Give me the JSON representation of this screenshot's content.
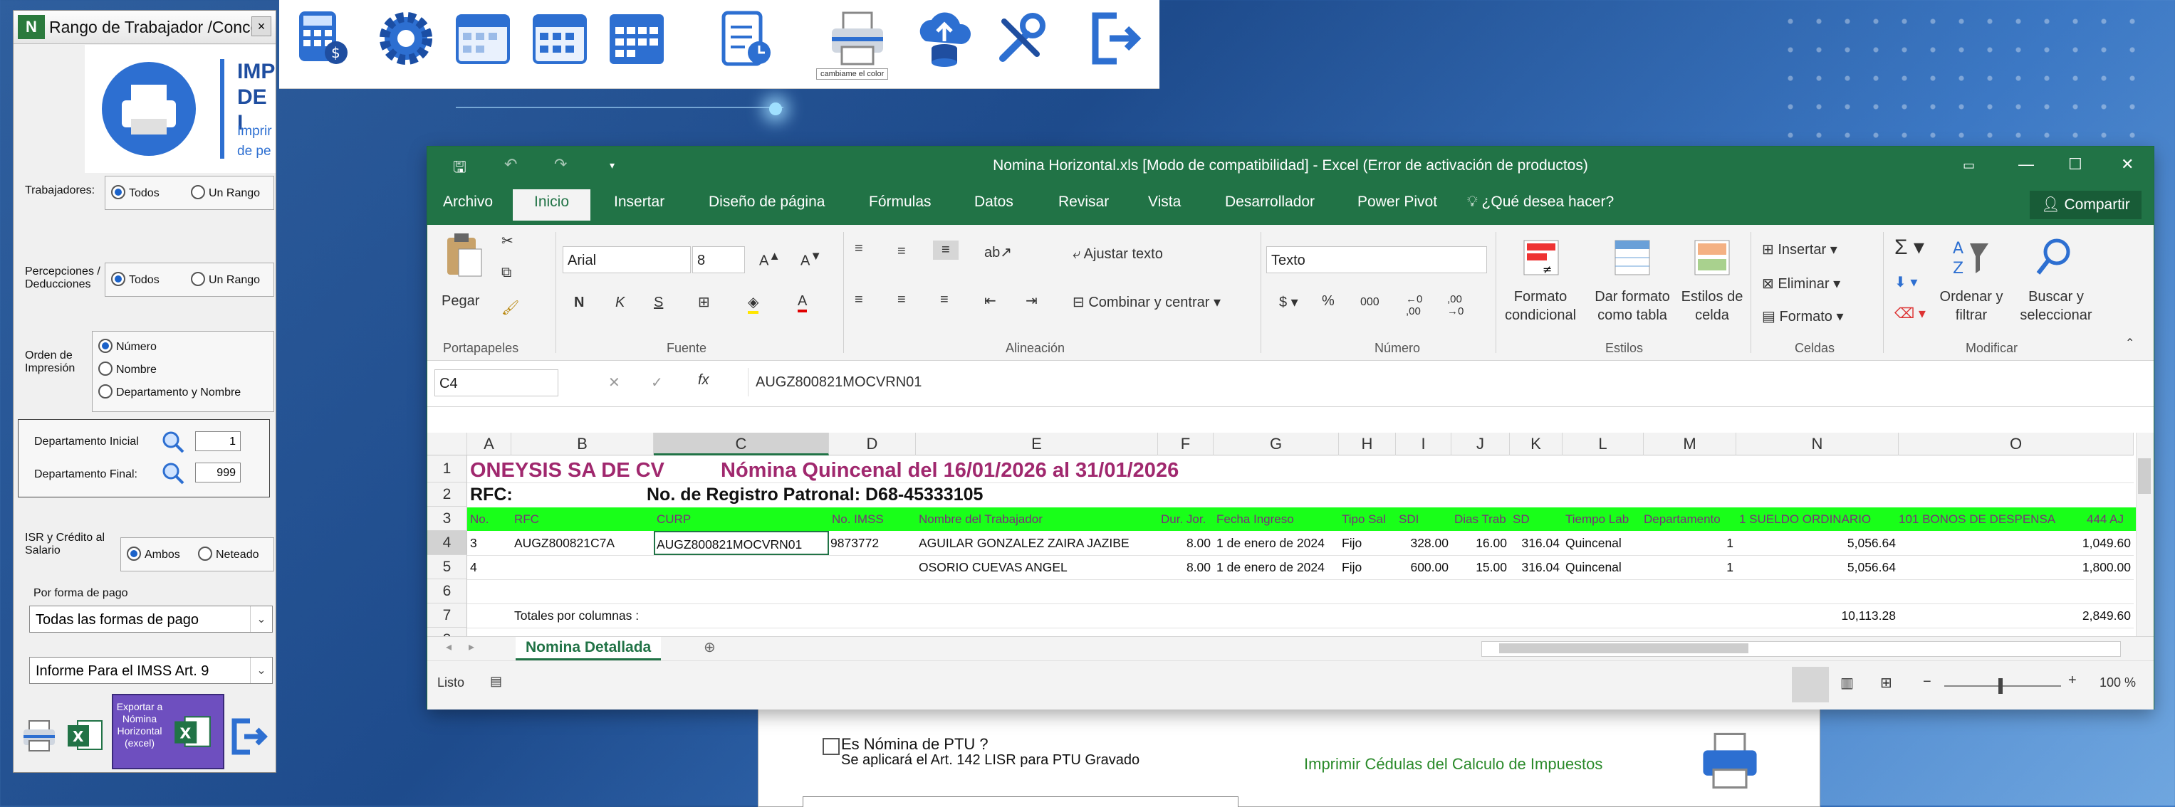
{
  "toolbar": {
    "tooltip": "cambiame el color",
    "icons": [
      "calculator-icon",
      "settings-gear-icon",
      "calendar-icon",
      "calendar-icon",
      "calendar-grid-icon",
      "checklist-clock-icon",
      "printer-icon",
      "cloud-upload-database-icon",
      "tools-icon",
      "exit-icon"
    ]
  },
  "dialog": {
    "title": "Rango de Trabajador /Concep",
    "close": "×",
    "banner_line1": "IMP",
    "banner_line2": "DE I",
    "banner_sub1": "Imprir",
    "banner_sub2": "de pe",
    "trabajadores_label": "Trabajadores:",
    "percepciones_label": "Percepciones / Deducciones",
    "todos": "Todos",
    "un_rango": "Un Rango",
    "orden_label": "Orden de Impresión",
    "orden_options": [
      "Número",
      "Nombre",
      "Departamento y Nombre"
    ],
    "depto_inicial_label": "Departamento Inicial",
    "depto_inicial_value": "1",
    "depto_final_label": "Departamento Final:",
    "depto_final_value": "999",
    "isr_label": "ISR y Crédito al Salario",
    "ambos": "Ambos",
    "neteado": "Neteado",
    "forma_pago_label": "Por forma de pago",
    "forma_pago_value": "Todas las formas de pago",
    "informe_value": "Informe Para el IMSS Art. 9",
    "export_label": "Exportar a Nómina Horizontal (excel)"
  },
  "background": {
    "ptu_checkbox": "Es Nómina de PTU ?",
    "ptu_note": "Se aplicará el Art. 142 LISR para PTU Gravado",
    "print_cedulas": "Imprimir Cédulas del Calculo de Impuestos"
  },
  "excel": {
    "title": "Nomina Horizontal.xls  [Modo de compatibilidad] - Excel (Error de activación de productos)",
    "tabs": [
      "Archivo",
      "Inicio",
      "Insertar",
      "Diseño de página",
      "Fórmulas",
      "Datos",
      "Revisar",
      "Vista",
      "Desarrollador",
      "Power Pivot"
    ],
    "tell_me": "¿Qué desea hacer?",
    "share": "Compartir",
    "ribbon": {
      "pegar": "Pegar",
      "portapapeles": "Portapapeles",
      "font_name": "Arial",
      "font_size": "8",
      "fuente": "Fuente",
      "ajustar_texto": "Ajustar texto",
      "combinar": "Combinar y centrar",
      "alineacion": "Alineación",
      "number_format": "Texto",
      "numero": "Número",
      "formato_condicional": "Formato condicional",
      "dar_formato": "Dar formato como tabla",
      "estilos_celda": "Estilos de celda",
      "estilos": "Estilos",
      "insertar": "Insertar",
      "eliminar": "Eliminar",
      "formato": "Formato",
      "celdas": "Celdas",
      "ordenar": "Ordenar y filtrar",
      "buscar": "Buscar y seleccionar",
      "modificar": "Modificar"
    },
    "name_box": "C4",
    "formula": "AUGZ800821MOCVRN01",
    "columns": [
      "A",
      "B",
      "C",
      "D",
      "E",
      "F",
      "G",
      "H",
      "I",
      "J",
      "K",
      "L",
      "M",
      "N",
      "O"
    ],
    "rows": [
      "1",
      "2",
      "3",
      "4",
      "5",
      "6",
      "7",
      "8"
    ],
    "row1_a": "ONEYSIS SA DE CV",
    "row1_title": "Nómina Quincenal del 16/01/2026 al 31/01/2026",
    "row2_rfc": "RFC:",
    "row2_registro": "No. de Registro Patronal: D68-45333105",
    "headers": [
      "No.",
      "RFC",
      "CURP",
      "No. IMSS",
      "Nombre del Trabajador",
      "Dur. Jor.",
      "Fecha Ingreso",
      "Tipo Sal",
      "SDI",
      "Dias Trab",
      "SD",
      "Tiempo Lab",
      "Departamento",
      "1 SUELDO ORDINARIO",
      "101 BONOS DE DESPENSA",
      "444 AJ"
    ],
    "data_rows": [
      [
        "3",
        "AUGZ800821C7A",
        "AUGZ800821MOCVRN01",
        "9873772",
        "AGUILAR GONZALEZ ZAIRA JAZIBE",
        "8.00",
        "1 de enero de 2024",
        "Fijo",
        "328.00",
        "16.00",
        "316.04",
        "Quincenal",
        "1",
        "5,056.64",
        "1,049.60"
      ],
      [
        "4",
        "",
        "",
        "",
        "OSORIO CUEVAS ANGEL",
        "8.00",
        "1 de enero de 2024",
        "Fijo",
        "600.00",
        "15.00",
        "316.04",
        "Quincenal",
        "1",
        "5,056.64",
        "1,800.00"
      ]
    ],
    "totales_label": "Totales por columnas :",
    "total_n": "10,113.28",
    "total_o": "2,849.60",
    "sheet_tab": "Nomina Detallada",
    "status_ready": "Listo",
    "zoom": "100 %"
  }
}
